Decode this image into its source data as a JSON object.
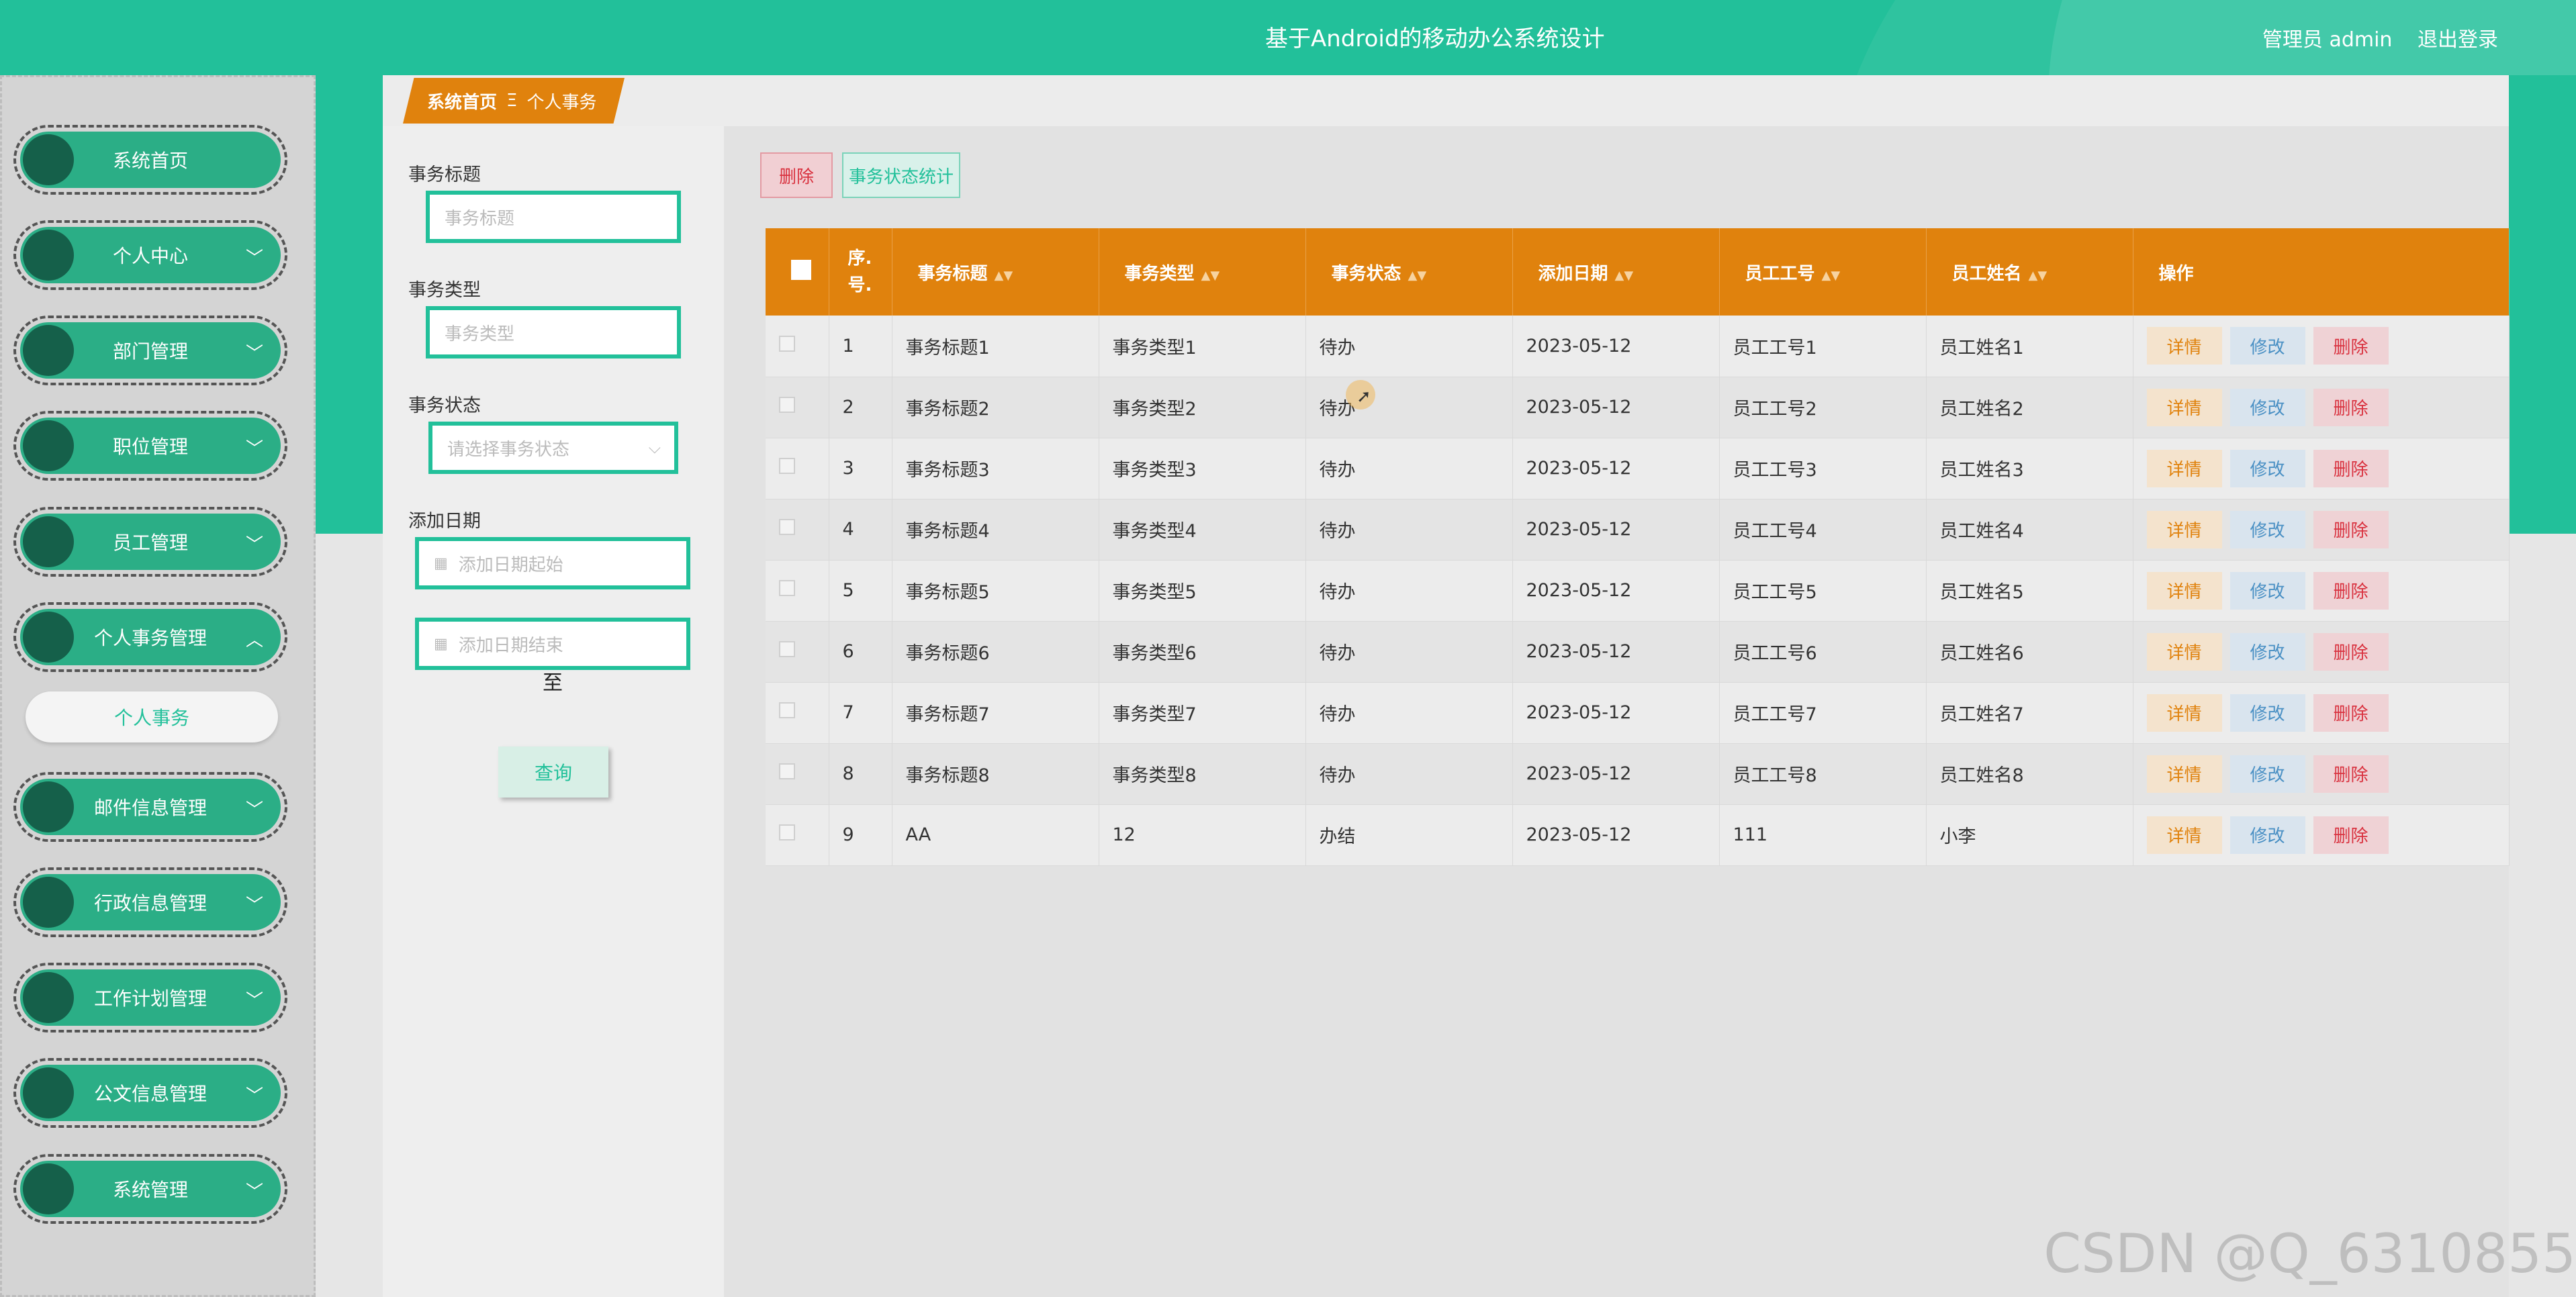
{
  "header": {
    "title": "基于Android的移动办公系统设计",
    "user_role": "管理员 admin",
    "logout": "退出登录"
  },
  "sidebar": {
    "items": [
      {
        "label": "系统首页",
        "has_chevron": false
      },
      {
        "label": "个人中心",
        "has_chevron": true
      },
      {
        "label": "部门管理",
        "has_chevron": true
      },
      {
        "label": "职位管理",
        "has_chevron": true
      },
      {
        "label": "员工管理",
        "has_chevron": true
      },
      {
        "label": "个人事务管理",
        "has_chevron": true,
        "expanded": true
      },
      {
        "label": "邮件信息管理",
        "has_chevron": true
      },
      {
        "label": "行政信息管理",
        "has_chevron": true
      },
      {
        "label": "工作计划管理",
        "has_chevron": true
      },
      {
        "label": "公文信息管理",
        "has_chevron": true
      },
      {
        "label": "系统管理",
        "has_chevron": true
      }
    ],
    "active_subitem": "个人事务"
  },
  "breadcrumb": {
    "home": "系统首页",
    "separator": "Ξ",
    "current": "个人事务"
  },
  "search": {
    "title_label": "事务标题",
    "title_placeholder": "事务标题",
    "type_label": "事务类型",
    "type_placeholder": "事务类型",
    "status_label": "事务状态",
    "status_placeholder": "请选择事务状态",
    "date_label": "添加日期",
    "date_start_placeholder": "添加日期起始",
    "date_to": "至",
    "date_end_placeholder": "添加日期结束",
    "query_button": "查询"
  },
  "toolbar": {
    "delete_label": "删除",
    "stats_label": "事务状态统计"
  },
  "table": {
    "headers": [
      "序.号.",
      "事务标题",
      "事务类型",
      "事务状态",
      "添加日期",
      "员工工号",
      "员工姓名",
      "操作"
    ],
    "header_seq_line1": "序.",
    "header_seq_line2": "号.",
    "rows": [
      {
        "seq": "1",
        "title": "事务标题1",
        "type": "事务类型1",
        "status": "待办",
        "date": "2023-05-12",
        "emp_no": "员工工号1",
        "emp_name": "员工姓名1"
      },
      {
        "seq": "2",
        "title": "事务标题2",
        "type": "事务类型2",
        "status": "待办",
        "date": "2023-05-12",
        "emp_no": "员工工号2",
        "emp_name": "员工姓名2"
      },
      {
        "seq": "3",
        "title": "事务标题3",
        "type": "事务类型3",
        "status": "待办",
        "date": "2023-05-12",
        "emp_no": "员工工号3",
        "emp_name": "员工姓名3"
      },
      {
        "seq": "4",
        "title": "事务标题4",
        "type": "事务类型4",
        "status": "待办",
        "date": "2023-05-12",
        "emp_no": "员工工号4",
        "emp_name": "员工姓名4"
      },
      {
        "seq": "5",
        "title": "事务标题5",
        "type": "事务类型5",
        "status": "待办",
        "date": "2023-05-12",
        "emp_no": "员工工号5",
        "emp_name": "员工姓名5"
      },
      {
        "seq": "6",
        "title": "事务标题6",
        "type": "事务类型6",
        "status": "待办",
        "date": "2023-05-12",
        "emp_no": "员工工号6",
        "emp_name": "员工姓名6"
      },
      {
        "seq": "7",
        "title": "事务标题7",
        "type": "事务类型7",
        "status": "待办",
        "date": "2023-05-12",
        "emp_no": "员工工号7",
        "emp_name": "员工姓名7"
      },
      {
        "seq": "8",
        "title": "事务标题8",
        "type": "事务类型8",
        "status": "待办",
        "date": "2023-05-12",
        "emp_no": "员工工号8",
        "emp_name": "员工姓名8"
      },
      {
        "seq": "9",
        "title": "AA",
        "type": "12",
        "status": "办结",
        "date": "2023-05-12",
        "emp_no": "111",
        "emp_name": "小李"
      }
    ],
    "actions": {
      "detail": "详情",
      "edit": "修改",
      "delete": "删除"
    }
  },
  "watermark": "CSDN @Q_6310855",
  "colors": {
    "primary": "#22c09a",
    "table_header": "#e0820d",
    "sidebar_pill": "#2bae86",
    "danger": "#d9323f"
  }
}
